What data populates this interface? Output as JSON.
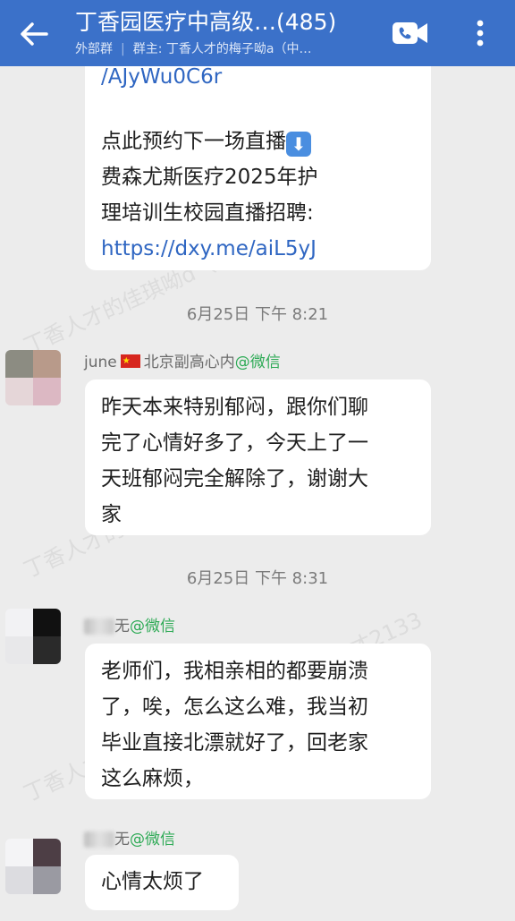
{
  "header": {
    "title": "丁香园医疗中高级…(485)",
    "group_type": "外部群",
    "owner": "群主: 丁香人才的梅子呦a（中…"
  },
  "messages": {
    "m1": {
      "link1": "/AJyWu0C6r",
      "line1": "点此预约下一场直播",
      "line2": "费森尤斯医疗2025年护",
      "line3": "理培训生校园直播招聘:",
      "link2": "https://dxy.me/aiL5yJ"
    },
    "time1": "6月25日  下午 8:21",
    "m2": {
      "sender_name": "june",
      "sender_org": "北京副高心内",
      "sender_tag": "@微信",
      "lines": [
        "昨天本来特别郁闷，跟你们聊",
        "完了心情好多了，今天上了一",
        "天班郁闷完全解除了，谢谢大",
        "家"
      ]
    },
    "time2": "6月25日  下午 8:31",
    "m3": {
      "sender_suffix": "无",
      "sender_tag": "@微信",
      "lines": [
        "老师们，我相亲相的都要崩溃",
        "了，唉，怎么这么难，我当初",
        "毕业直接北漂就好了，回老家",
        "这么麻烦，"
      ]
    },
    "m4": {
      "sender_suffix": "无",
      "sender_tag": "@微信",
      "lines": [
        "心情太烦了"
      ]
    }
  },
  "watermark": "丁香人才的佳琪呦d（小白）@丁香人才2133",
  "colors": {
    "header_bg": "#3b71c9",
    "chat_bg": "#ececec",
    "link": "#2f66c2",
    "wechat_tag": "#2daa55"
  },
  "icons": [
    "back-arrow-icon",
    "video-call-icon",
    "more-vert-icon",
    "down-arrow-emoji-icon"
  ]
}
